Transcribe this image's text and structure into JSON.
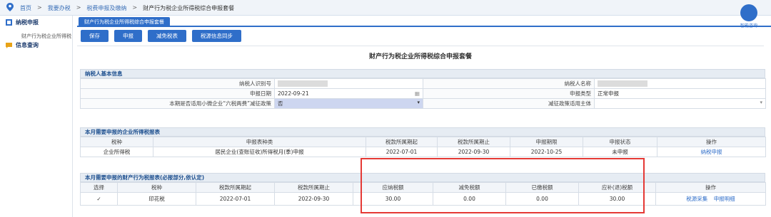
{
  "breadcrumb": [
    "首页",
    "我要办税",
    "税费申报及缴纳",
    "财产行为税企业所得税综合申报套餐"
  ],
  "breadcrumb_sep": ">",
  "sidebar": {
    "items": [
      {
        "label": "纳税申报",
        "sub": "财产行为税企业所得税"
      },
      {
        "label": "信息查询"
      }
    ]
  },
  "tab": {
    "label": "财产行为税企业所得税综合申报套餐"
  },
  "assistant": {
    "label": "智能咨询"
  },
  "toolbar": {
    "save": "保存",
    "declare": "申报",
    "tax_relief": "减免税表",
    "sync": "税源信息同步"
  },
  "form": {
    "title": "财产行为税企业所得税综合申报套餐",
    "basic": {
      "header": "纳税人基本信息",
      "taxpayer_id_label": "纳税人识别号",
      "taxpayer_name_label": "纳税人名称",
      "declare_date_label": "申报日期",
      "declare_date": "2022-09-21",
      "declare_type_label": "申报类型",
      "declare_type": "正常申报",
      "policy_label": "本期是否适用小微企业“六税两费”减征政策",
      "policy_value": "否",
      "policy_subject_label": "减征政策适用主体",
      "policy_subject_value": ""
    },
    "cit": {
      "header": "本月需要申报的企业所得税报表",
      "columns": [
        "税种",
        "申报表种类",
        "税款所属期起",
        "税款所属期止",
        "申报期限",
        "申报状态",
        "操作"
      ],
      "rows": [
        [
          "企业所得税",
          "居民企业(查账征收)所得税月(季)申报",
          "2022-07-01",
          "2022-09-30",
          "2022-10-25",
          "未申报",
          "纳税申报"
        ]
      ]
    },
    "property": {
      "header": "本月需要申报的财产行为税报表(必报部分,依认定)",
      "columns": [
        "选择",
        "税种",
        "税款所属期起",
        "税款所属期止",
        "应纳税额",
        "减免税额",
        "已缴税额",
        "应补(退)税额",
        "操作"
      ],
      "rows": [
        {
          "check": "✓",
          "tax": "印花税",
          "start": "2022-07-01",
          "end": "2022-09-30",
          "payable": "30.00",
          "relief": "0.00",
          "paid": "0.00",
          "due": "30.00",
          "op1": "税源采集",
          "op2": "申报明细"
        }
      ]
    }
  }
}
